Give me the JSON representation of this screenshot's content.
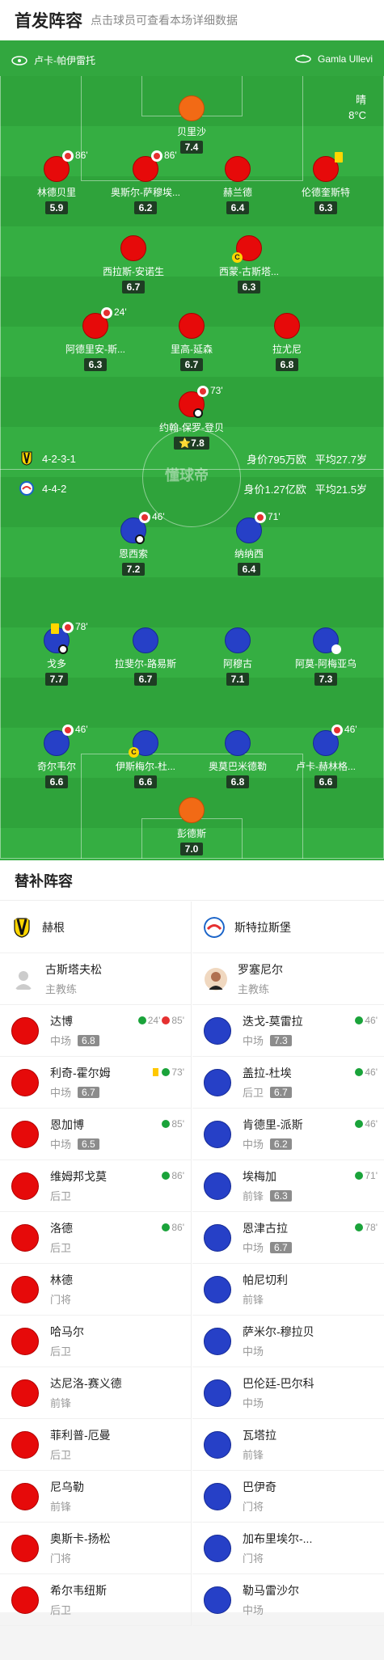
{
  "header": {
    "title": "首发阵容",
    "subtitle": "点击球员可查看本场详细数据"
  },
  "venue": {
    "team_home": "卢卡-帕伊雷托",
    "stadium": "Gamla Ullevi"
  },
  "weather": {
    "cond": "晴",
    "temp": "8°C"
  },
  "home": {
    "formation": "4-2-3-1",
    "value": "身价795万欧",
    "age": "平均27.7岁"
  },
  "away": {
    "formation": "4-4-2",
    "value": "身价1.27亿欧",
    "age": "平均21.5岁"
  },
  "watermark": "懂球帝",
  "pitch_players": [
    {
      "id": "p1",
      "name": "贝里沙",
      "rating": "7.4",
      "color": "orange"
    },
    {
      "id": "p2",
      "name": "林德贝里",
      "rating": "5.9",
      "color": "red",
      "sub": "86'"
    },
    {
      "id": "p3",
      "name": "奥斯尔-萨穆埃...",
      "rating": "6.2",
      "color": "red",
      "sub": "86'"
    },
    {
      "id": "p4",
      "name": "赫兰德",
      "rating": "6.4",
      "color": "red"
    },
    {
      "id": "p5",
      "name": "伦德奎斯特",
      "rating": "6.3",
      "color": "red",
      "yellow": true
    },
    {
      "id": "p6",
      "name": "西拉斯-安诺生",
      "rating": "6.7",
      "color": "red"
    },
    {
      "id": "p7",
      "name": "西蒙-古斯塔...",
      "rating": "6.3",
      "color": "red",
      "captain": "C"
    },
    {
      "id": "p8",
      "name": "阿德里安-斯...",
      "rating": "6.3",
      "color": "red",
      "sub": "24'"
    },
    {
      "id": "p9",
      "name": "里高-延森",
      "rating": "6.7",
      "color": "red"
    },
    {
      "id": "p10",
      "name": "拉尤尼",
      "rating": "6.8",
      "color": "red"
    },
    {
      "id": "p11",
      "name": "约翰-保罗-登贝",
      "rating": "⭐7.8",
      "color": "red",
      "sub": "73'",
      "goal": true
    },
    {
      "id": "p12",
      "name": "恩西索",
      "rating": "7.2",
      "color": "blue",
      "sub": "46'",
      "goal": true
    },
    {
      "id": "p13",
      "name": "纳纳西",
      "rating": "6.4",
      "color": "blue",
      "sub": "71'"
    },
    {
      "id": "p14",
      "name": "戈多",
      "rating": "7.7",
      "color": "blue",
      "sub": "78'",
      "yellow": true,
      "goal": true
    },
    {
      "id": "p15",
      "name": "拉斐尔-路易斯",
      "rating": "6.7",
      "color": "blue"
    },
    {
      "id": "p16",
      "name": "阿穆古",
      "rating": "7.1",
      "color": "blue"
    },
    {
      "id": "p17",
      "name": "阿莫-阿梅亚乌",
      "rating": "7.3",
      "color": "blue",
      "assist": true
    },
    {
      "id": "p18",
      "name": "奇尔韦尔",
      "rating": "6.6",
      "color": "blue",
      "sub": "46'"
    },
    {
      "id": "p19",
      "name": "伊斯梅尔-杜...",
      "rating": "6.6",
      "color": "blue",
      "captain": "C"
    },
    {
      "id": "p20",
      "name": "奥莫巴米德勒",
      "rating": "6.8",
      "color": "blue"
    },
    {
      "id": "p21",
      "name": "卢卡-赫林格...",
      "rating": "6.6",
      "color": "blue",
      "sub": "46'"
    },
    {
      "id": "p22",
      "name": "彭德斯",
      "rating": "7.0",
      "color": "orange"
    }
  ],
  "subs": {
    "title": "替补阵容",
    "left": {
      "team": "赫根",
      "coach": {
        "name": "古斯塔夫松",
        "role": "主教练"
      },
      "players": [
        {
          "name": "达博",
          "pos": "中场",
          "rating": "6.8",
          "in": "24'",
          "out": "85'"
        },
        {
          "name": "利奇-霍尔姆",
          "pos": "中场",
          "rating": "6.7",
          "in": "73'",
          "yellow": true
        },
        {
          "name": "恩加博",
          "pos": "中场",
          "rating": "6.5",
          "in": "85'"
        },
        {
          "name": "维姆邦戈莫",
          "pos": "后卫",
          "in": "86'"
        },
        {
          "name": "洛德",
          "pos": "后卫",
          "in": "86'"
        },
        {
          "name": "林德",
          "pos": "门将"
        },
        {
          "name": "哈马尔",
          "pos": "后卫"
        },
        {
          "name": "达尼洛-赛义德",
          "pos": "前锋"
        },
        {
          "name": "菲利普-厄曼",
          "pos": "后卫"
        },
        {
          "name": "尼乌勒",
          "pos": "前锋"
        },
        {
          "name": "奥斯卡-扬松",
          "pos": "门将"
        },
        {
          "name": "希尔韦纽斯",
          "pos": "后卫"
        }
      ]
    },
    "right": {
      "team": "斯特拉斯堡",
      "coach": {
        "name": "罗塞尼尔",
        "role": "主教练"
      },
      "players": [
        {
          "name": "迭戈-莫雷拉",
          "pos": "中场",
          "rating": "7.3",
          "in": "46'"
        },
        {
          "name": "盖拉-杜埃",
          "pos": "后卫",
          "rating": "6.7",
          "in": "46'"
        },
        {
          "name": "肯德里-派斯",
          "pos": "中场",
          "rating": "6.2",
          "in": "46'"
        },
        {
          "name": "埃梅加",
          "pos": "前锋",
          "rating": "6.3",
          "in": "71'"
        },
        {
          "name": "恩津古拉",
          "pos": "中场",
          "rating": "6.7",
          "in": "78'"
        },
        {
          "name": "帕尼切利",
          "pos": "前锋"
        },
        {
          "name": "萨米尔-穆拉贝",
          "pos": "中场"
        },
        {
          "name": "巴伦廷-巴尔科",
          "pos": "中场"
        },
        {
          "name": "瓦塔拉",
          "pos": "前锋"
        },
        {
          "name": "巴伊奇",
          "pos": "门将"
        },
        {
          "name": "加布里埃尔-...",
          "pos": "门将"
        },
        {
          "name": "勒马雷沙尔",
          "pos": "中场"
        }
      ]
    }
  }
}
